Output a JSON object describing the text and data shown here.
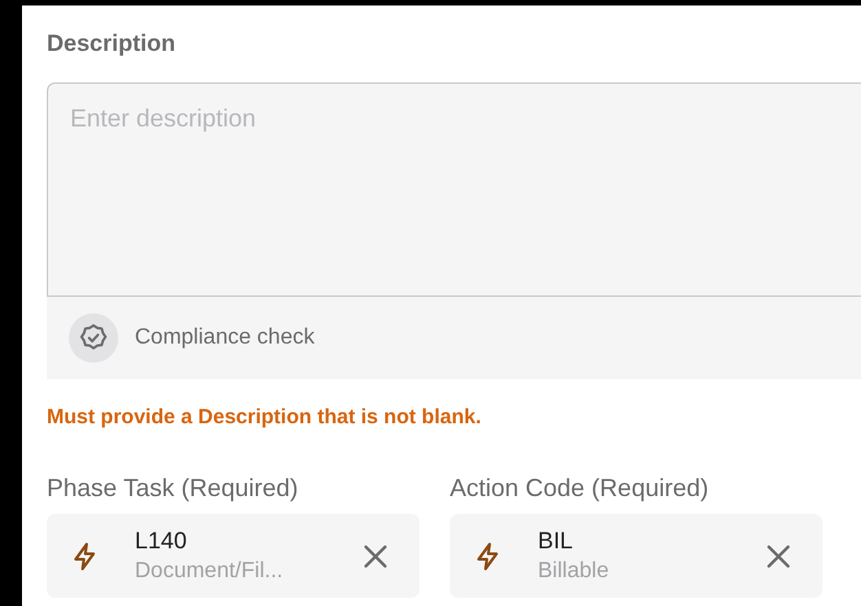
{
  "description": {
    "label": "Description",
    "placeholder": "Enter description"
  },
  "compliance": {
    "label": "Compliance check"
  },
  "error": "Must provide a Description that is not blank.",
  "fields": [
    {
      "label": "Phase Task (Required)",
      "code": "L140",
      "detail": "Document/Fil..."
    },
    {
      "label": "Action Code (Required)",
      "code": "BIL",
      "detail": "Billable"
    }
  ]
}
